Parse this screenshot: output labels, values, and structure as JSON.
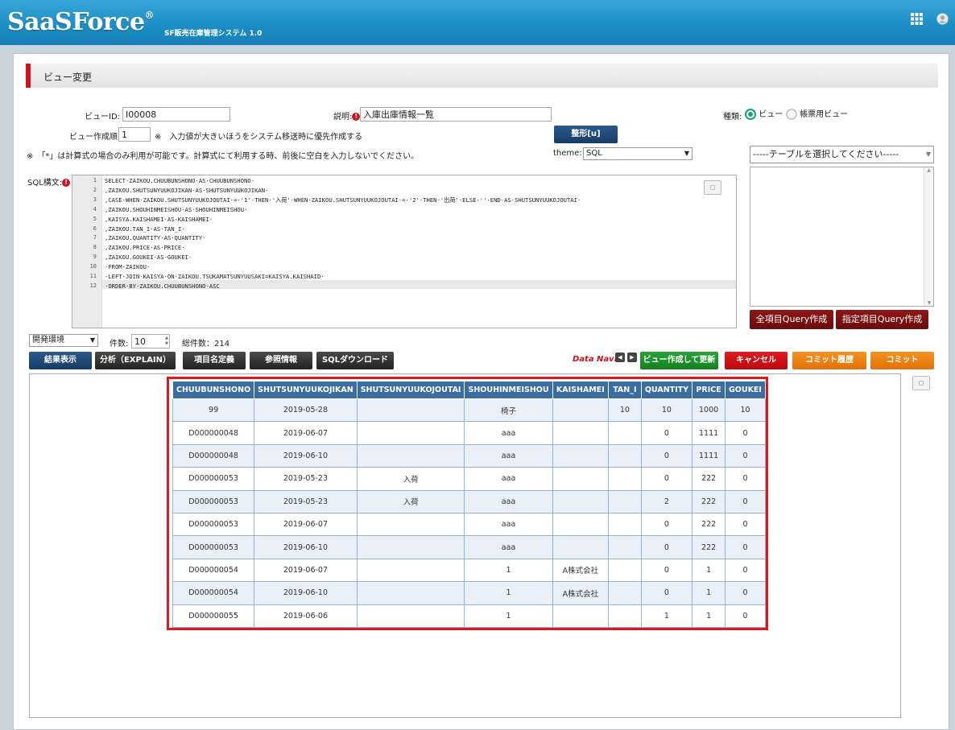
{
  "header": {
    "logo": "SaaSForce",
    "logo_mark": "®",
    "system_name": "SF販売在庫管理システム 1.0"
  },
  "page": {
    "title": "ビュー変更"
  },
  "form": {
    "view_id_label": "ビューID:",
    "view_id_value": "I00008",
    "description_label": "説明:",
    "description_value": "入庫出庫情報一覧",
    "type_label": "種類:",
    "type_options": [
      "ビュー",
      "帳票用ビュー"
    ],
    "order_label": "ビュー作成順:",
    "order_value": "1",
    "order_note": "※　入力値が大きいほうをシステム移送時に優先作成する",
    "format_button": "整形[u]",
    "calc_note": "※　「*」は計算式の場合のみ利用が可能です。計算式にて利用する時、前後に空白を入力しないでください。",
    "theme_label": "theme:",
    "theme_value": "SQL",
    "table_select_placeholder": "-----テーブルを選択してください-----",
    "sql_label": "SQL構文:"
  },
  "sql": {
    "line_numbers": [
      "1",
      "2",
      "3",
      "4",
      "5",
      "6",
      "7",
      "8",
      "9",
      "10",
      "11",
      "12"
    ],
    "lines": [
      "SELECT·ZAIKOU.CHUUBUNSHONO·AS·CHUUBUNSHONO·",
      ",ZAIKOU.SHUTSUNYUUKOJIKAN·AS·SHUTSUNYUUKOJIKAN·",
      ",CASE·WHEN·ZAIKOU.SHUTSUNYUUKOJOUTAI·=·'1'·THEN·'入荷'·WHEN·ZAIKOU.SHUTSUNYUUKOJOUTAI·=·'2'·THEN·'出荷'·ELSE·''·END·AS·SHUTSUNYUUKOJOUTAI·",
      ",ZAIKOU.SHOUHINMEISHOU·AS·SHOUHINMEISHOU·",
      ",KAISYA.KAISHAMEI·AS·KAISHAMEI·",
      ",ZAIKOU.TAN_I·AS·TAN_I·",
      ",ZAIKOU.QUANTITY·AS·QUANTITY·",
      ",ZAIKOU.PRICE·AS·PRICE·",
      ",ZAIKOU.GOUKEI·AS·GOUKEI·",
      "·FROM·ZAIKOU·",
      "·LEFT·JOIN·KAISYA·ON·ZAIKOU.TSUKAMATSUNYUUSAKI=KAISYA.KAISHAID·",
      "·ORDER·BY·ZAIKOU.CHUUBUNSHONO·ASC"
    ]
  },
  "right_buttons": {
    "all_query": "全項目Query作成",
    "selected_query": "指定項目Query作成"
  },
  "controls": {
    "env_value": "開発環境",
    "count_label": "件数:",
    "count_value": "10",
    "total_label": "総件数：214"
  },
  "toolbar": {
    "result": "結果表示",
    "explain": "分析（EXPLAIN）",
    "item_def": "項目名定義",
    "ref_info": "参照情報",
    "sql_download": "SQLダウンロード",
    "data_navi": "Data Navi",
    "create_update": "ビュー作成して更新",
    "cancel": "キャンセル",
    "commit_history": "コミット履歴",
    "commit": "コミット"
  },
  "table": {
    "columns": [
      "CHUUBUNSHONO",
      "SHUTSUNYUUKOJIKAN",
      "SHUTSUNYUUKOJOUTAI",
      "SHOUHINMEISHOU",
      "KAISHAMEI",
      "TAN_I",
      "QUANTITY",
      "PRICE",
      "GOUKEI"
    ],
    "rows": [
      [
        "99",
        "2019-05-28",
        "",
        "椅子",
        "",
        "10",
        "10",
        "1000",
        "10"
      ],
      [
        "D000000048",
        "2019-06-07",
        "",
        "aaa",
        "",
        "",
        "0",
        "1111",
        "0"
      ],
      [
        "D000000048",
        "2019-06-10",
        "",
        "aaa",
        "",
        "",
        "0",
        "1111",
        "0"
      ],
      [
        "D000000053",
        "2019-05-23",
        "入荷",
        "aaa",
        "",
        "",
        "0",
        "222",
        "0"
      ],
      [
        "D000000053",
        "2019-05-23",
        "入荷",
        "aaa",
        "",
        "",
        "2",
        "222",
        "0"
      ],
      [
        "D000000053",
        "2019-06-07",
        "",
        "aaa",
        "",
        "",
        "0",
        "222",
        "0"
      ],
      [
        "D000000053",
        "2019-06-10",
        "",
        "aaa",
        "",
        "",
        "0",
        "222",
        "0"
      ],
      [
        "D000000054",
        "2019-06-07",
        "",
        "1",
        "A株式会社",
        "",
        "0",
        "1",
        "0"
      ],
      [
        "D000000054",
        "2019-06-10",
        "",
        "1",
        "A株式会社",
        "",
        "0",
        "1",
        "0"
      ],
      [
        "D000000055",
        "2019-06-06",
        "",
        "1",
        "",
        "",
        "1",
        "1",
        "0"
      ]
    ]
  },
  "colors": {
    "header_blue": "#1c8fc6",
    "table_header": "#3a6ea0",
    "accent_red": "#d0121b",
    "commit_orange": "#f08a1a",
    "create_green": "#1f9a2e"
  }
}
